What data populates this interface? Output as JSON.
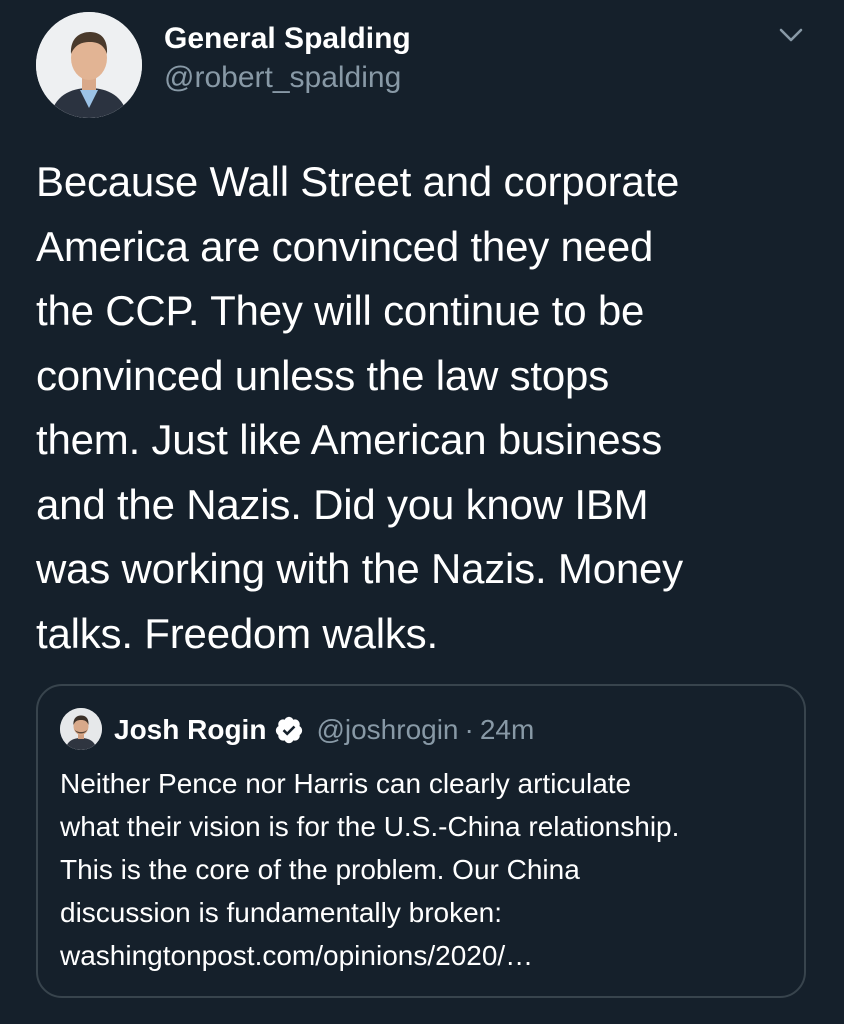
{
  "tweet": {
    "author": {
      "display_name": "General Spalding",
      "handle": "@robert_spalding"
    },
    "text": "Because Wall Street and corporate\nAmerica are convinced they need\nthe CCP. They will continue to be\nconvinced unless the law stops\nthem. Just like American business\nand the Nazis. Did you know IBM\nwas working with the Nazis. Money\ntalks. Freedom walks.",
    "menu_icon": "chevron-down-icon"
  },
  "quote": {
    "author": {
      "display_name": "Josh Rogin",
      "handle": "@joshrogin",
      "verified": true
    },
    "separator": "·",
    "time": "24m",
    "text": "Neither Pence nor Harris can clearly articulate\nwhat their vision is for the U.S.-China relationship.\nThis is the core of the problem. Our China\ndiscussion is fundamentally broken:\nwashingtonpost.com/opinions/2020/…"
  },
  "colors": {
    "background": "#15202b",
    "text": "#ffffff",
    "secondary": "#8899a6",
    "border": "#38444d"
  }
}
